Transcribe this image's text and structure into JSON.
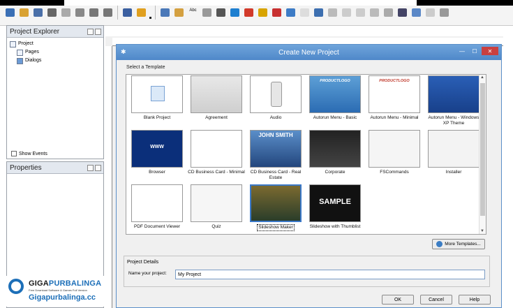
{
  "toolbar": {
    "icons": [
      "select-icon",
      "open-icon",
      "save-icon",
      "cut-icon",
      "copy-icon",
      "paste-icon",
      "undo-icon",
      "redo-icon",
      "preview-icon",
      "build-icon",
      "button-object-icon",
      "image-object-icon",
      "text-object-icon",
      "paragraph-object-icon",
      "3d-object-icon",
      "web-object-icon",
      "flash-object-icon",
      "slideshow-object-icon",
      "pdf-object-icon",
      "browser-object-icon",
      "input-object-icon",
      "checkbox-object-icon",
      "radio-object-icon",
      "combobox-object-icon",
      "listbox-object-icon",
      "grid-object-icon",
      "table-object-icon",
      "progress-object-icon",
      "tree-object-icon",
      "rectangle-object-icon",
      "pen-object-icon"
    ],
    "abc_label": "Abc"
  },
  "project_explorer": {
    "title": "Project Explorer",
    "items": [
      {
        "label": "Project"
      },
      {
        "label": "Pages"
      },
      {
        "label": "Dialogs"
      }
    ],
    "show_events": "Show Events"
  },
  "properties": {
    "title": "Properties"
  },
  "dialog": {
    "title": "Create New Project",
    "select_template_label": "Select a Template",
    "templates": [
      {
        "label": "Blank Project"
      },
      {
        "label": "Agreement"
      },
      {
        "label": "Audio"
      },
      {
        "label": "Autorun Menu - Basic"
      },
      {
        "label": "Autorun Menu - Minimal"
      },
      {
        "label": "Autorun Menu - Windows XP Theme"
      },
      {
        "label": "Browser"
      },
      {
        "label": "CD Business Card - Minimal"
      },
      {
        "label": "CD Business Card - Real Estate"
      },
      {
        "label": "Corporate"
      },
      {
        "label": "FSCommands"
      },
      {
        "label": "Installer"
      },
      {
        "label": "PDF Document Viewer"
      },
      {
        "label": "Quiz"
      },
      {
        "label": "Slideshow Maker"
      },
      {
        "label": "Slideshow with Thumblist"
      }
    ],
    "thumb_text": {
      "productlogo": "PRODUCTLOGO",
      "www": "WWW",
      "john_smith": "JOHN SMITH",
      "sample": "SAMPLE"
    },
    "more_templates": "More Templates...",
    "project_details_label": "Project Details",
    "name_label": "Name your project:",
    "name_value": "My Project",
    "ok": "OK",
    "cancel": "Cancel",
    "help": "Help"
  },
  "watermark": {
    "brand_a": "GIGA",
    "brand_b": "PURBALINGA",
    "tagline": "Free Download Software & Games Full Version",
    "site": "Gigapurbalinga.cc"
  }
}
